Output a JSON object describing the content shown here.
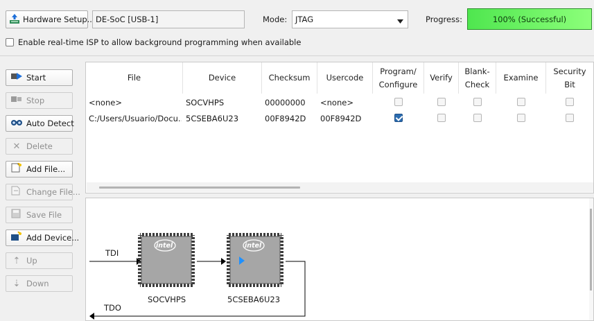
{
  "top": {
    "hardware_setup_label": "Hardware Setup...",
    "hardware_value": "DE-SoC [USB-1]",
    "mode_label": "Mode:",
    "mode_value": "JTAG",
    "progress_label": "Progress:",
    "progress_text": "100% (Successful)",
    "progress_value": 1.0,
    "isp_label": "Enable real-time ISP to allow background programming when available",
    "isp_checked": false
  },
  "side_buttons": [
    {
      "label": "Start",
      "icon": "start-icon",
      "enabled": true
    },
    {
      "label": "Stop",
      "icon": "stop-icon",
      "enabled": false
    },
    {
      "label": "Auto Detect",
      "icon": "auto-detect-icon",
      "enabled": true
    },
    {
      "label": "Delete",
      "icon": "delete-icon",
      "enabled": false
    },
    {
      "label": "Add File...",
      "icon": "add-file-icon",
      "enabled": true
    },
    {
      "label": "Change File...",
      "icon": "change-file-icon",
      "enabled": false
    },
    {
      "label": "Save File",
      "icon": "save-file-icon",
      "enabled": false
    },
    {
      "label": "Add Device...",
      "icon": "add-device-icon",
      "enabled": true
    },
    {
      "label": "Up",
      "icon": "up-icon",
      "enabled": false
    },
    {
      "label": "Down",
      "icon": "down-icon",
      "enabled": false
    }
  ],
  "table": {
    "headers": {
      "file": "File",
      "device": "Device",
      "checksum": "Checksum",
      "usercode": "Usercode",
      "program_1": "Program/",
      "program_2": "Configure",
      "verify": "Verify",
      "blank_1": "Blank-",
      "blank_2": "Check",
      "examine": "Examine",
      "security_1": "Security",
      "security_2": "Bit"
    },
    "rows": [
      {
        "file": "<none>",
        "device": "SOCVHPS",
        "checksum": "00000000",
        "usercode": "<none>",
        "program": false,
        "verify": false,
        "blank": false,
        "examine": false,
        "security": false
      },
      {
        "file": "C:/Users/Usuario/Docu...",
        "device": "5CSEBA6U23",
        "checksum": "00F8942D",
        "usercode": "00F8942D",
        "program": true,
        "verify": false,
        "blank": false,
        "examine": false,
        "security": false
      }
    ]
  },
  "chain": {
    "tdi_label": "TDI",
    "tdo_label": "TDO",
    "chips": [
      {
        "name": "SOCVHPS",
        "brand": "intel",
        "selected": false
      },
      {
        "name": "5CSEBA6U23",
        "brand": "intel",
        "selected": true
      }
    ]
  },
  "colors": {
    "progress_fill": "#5cf05c",
    "checkbox_checked": "#2b6cb0",
    "chip_body": "#a6a6a6",
    "selection_arrow": "#1e90ff"
  }
}
